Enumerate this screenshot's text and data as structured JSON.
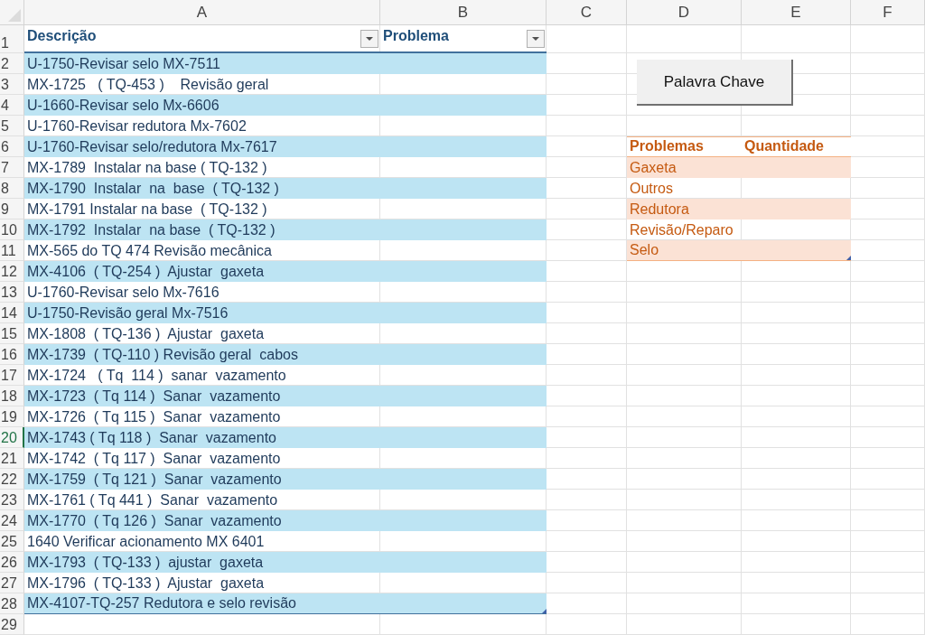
{
  "column_headers": [
    "A",
    "B",
    "C",
    "D",
    "E",
    "F"
  ],
  "row_numbers": [
    {
      "label": "1",
      "selected": false
    },
    {
      "label": "2",
      "selected": false
    },
    {
      "label": "3",
      "selected": false
    },
    {
      "label": "4",
      "selected": false
    },
    {
      "label": "5",
      "selected": false
    },
    {
      "label": "6",
      "selected": false
    },
    {
      "label": "7",
      "selected": false
    },
    {
      "label": "8",
      "selected": false
    },
    {
      "label": "9",
      "selected": false
    },
    {
      "label": "10",
      "selected": false
    },
    {
      "label": "11",
      "selected": false
    },
    {
      "label": "12",
      "selected": false
    },
    {
      "label": "13",
      "selected": false
    },
    {
      "label": "14",
      "selected": false
    },
    {
      "label": "15",
      "selected": false
    },
    {
      "label": "16",
      "selected": false
    },
    {
      "label": "17",
      "selected": false
    },
    {
      "label": "18",
      "selected": false
    },
    {
      "label": "19",
      "selected": false
    },
    {
      "label": "20",
      "selected": true
    },
    {
      "label": "21",
      "selected": false
    },
    {
      "label": "22",
      "selected": false
    },
    {
      "label": "23",
      "selected": false
    },
    {
      "label": "24",
      "selected": false
    },
    {
      "label": "25",
      "selected": false
    },
    {
      "label": "26",
      "selected": false
    },
    {
      "label": "27",
      "selected": false
    },
    {
      "label": "28",
      "selected": false
    },
    {
      "label": "29",
      "selected": false
    }
  ],
  "main_table": {
    "columns": [
      {
        "label": "Descrição",
        "filter": true
      },
      {
        "label": "Problema",
        "filter": true
      }
    ],
    "rows": [
      "U-1750-Revisar selo MX-7511",
      "MX-1725   ( TQ-453 )    Revisão geral",
      "U-1660-Revisar selo Mx-6606",
      "U-1760-Revisar redutora Mx-7602",
      "U-1760-Revisar selo/redutora Mx-7617",
      "MX-1789  Instalar na base ( TQ-132 )",
      "MX-1790  Instalar  na  base  ( TQ-132 )",
      "MX-1791 Instalar na base  ( TQ-132 )",
      "MX-1792  Instalar  na base  ( TQ-132 )",
      "MX-565 do TQ 474 Revisão mecânica",
      "MX-4106  ( TQ-254 )  Ajustar  gaxeta",
      "U-1760-Revisar selo Mx-7616",
      "U-1750-Revisão geral Mx-7516",
      "MX-1808  ( TQ-136 )  Ajustar  gaxeta",
      "MX-1739  ( TQ-110 ) Revisão geral  cabos",
      "MX-1724   ( Tq  114 )  sanar  vazamento",
      "MX-1723  ( Tq 114 )  Sanar  vazamento",
      "MX-1726  ( Tq 115 )  Sanar  vazamento",
      "MX-1743 ( Tq 118 )  Sanar  vazamento",
      "MX-1742  ( Tq 117 )  Sanar  vazamento",
      "MX-1759  ( Tq 121 )  Sanar  vazamento",
      "MX-1761 ( Tq 441 )  Sanar  vazamento",
      "MX-1770  ( Tq 126 )  Sanar  vazamento",
      "1640 Verificar acionamento MX 6401",
      "MX-1793  ( TQ-133 )  ajustar  gaxeta",
      "MX-1796  ( TQ-133 )  Ajustar  gaxeta",
      "MX-4107-TQ-257 Redutora e selo revisão"
    ]
  },
  "button": {
    "label": "Palavra Chave"
  },
  "problems_table": {
    "columns": [
      "Problemas",
      "Quantidade"
    ],
    "rows": [
      "Gaxeta",
      "Outros",
      "Redutora",
      "Revisão/Reparo",
      "Selo"
    ]
  }
}
